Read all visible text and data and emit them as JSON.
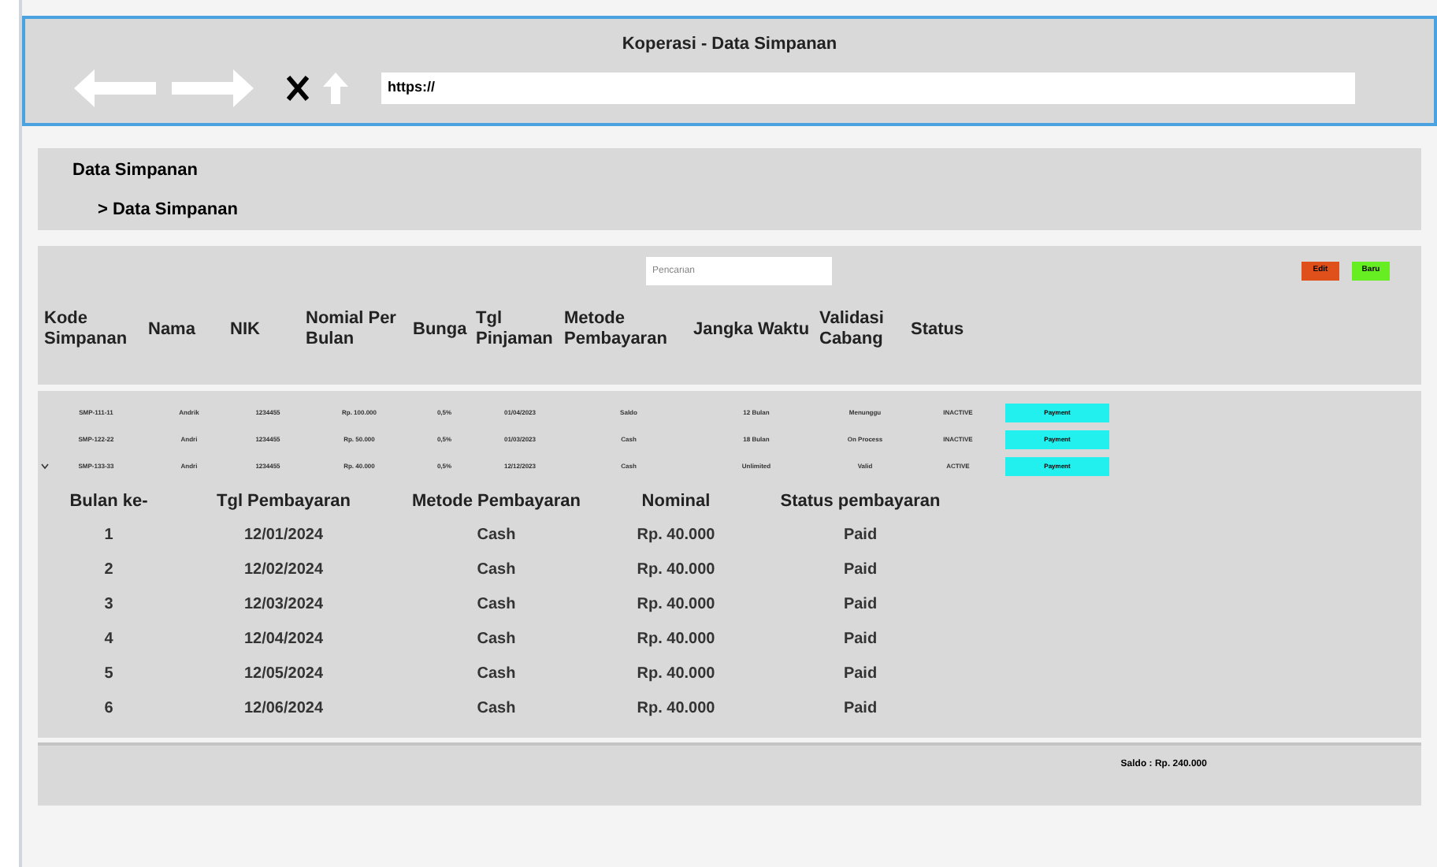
{
  "window": {
    "title": "Koperasi - Data Simpanan",
    "address": "https://"
  },
  "breadcrumb": {
    "title": "Data Simpanan",
    "item": "> Data Simpanan"
  },
  "toolbar": {
    "search_placeholder": "Pencarian",
    "buttons": [
      {
        "label": "Edit",
        "color": "#e0501a"
      },
      {
        "label": "Baru",
        "color": "#66ee22"
      }
    ]
  },
  "table": {
    "columns": [
      "Kode Simpanan",
      "Nama",
      "NIK",
      "Nomial Per Bulan",
      "Bunga",
      "Tgl Pinjaman",
      "Metode Pembayaran",
      "Jangka Waktu",
      "Validasi Cabang",
      "Status"
    ],
    "rows": [
      {
        "expanded": false,
        "cells": [
          "SMP-111-11",
          "Andrik",
          "1234455",
          "Rp. 100.000",
          "0,5%",
          "01/04/2023",
          "Saldo",
          "12 Bulan",
          "Menunggu",
          "INACTIVE"
        ],
        "action": "Payment"
      },
      {
        "expanded": false,
        "cells": [
          "SMP-122-22",
          "Andri",
          "1234455",
          "Rp. 50.000",
          "0,5%",
          "01/03/2023",
          "Cash",
          "18 Bulan",
          "On Process",
          "INACTIVE"
        ],
        "action": "Payment"
      },
      {
        "expanded": true,
        "cells": [
          "SMP-133-33",
          "Andri",
          "1234455",
          "Rp. 40.000",
          "0,5%",
          "12/12/2023",
          "Cash",
          "Unlimited",
          "Valid",
          "ACTIVE"
        ],
        "action": "Payment"
      }
    ]
  },
  "payments": {
    "columns": [
      "Bulan ke-",
      "Tgl Pembayaran",
      "Metode Pembayaran",
      "Nominal",
      "Status pembayaran"
    ],
    "rows": [
      [
        "1",
        "12/01/2024",
        "Cash",
        "Rp. 40.000",
        "Paid"
      ],
      [
        "2",
        "12/02/2024",
        "Cash",
        "Rp. 40.000",
        "Paid"
      ],
      [
        "3",
        "12/03/2024",
        "Cash",
        "Rp. 40.000",
        "Paid"
      ],
      [
        "4",
        "12/04/2024",
        "Cash",
        "Rp. 40.000",
        "Paid"
      ],
      [
        "5",
        "12/05/2024",
        "Cash",
        "Rp. 40.000",
        "Paid"
      ],
      [
        "6",
        "12/06/2024",
        "Cash",
        "Rp. 40.000",
        "Paid"
      ]
    ]
  },
  "saldo": "Saldo : Rp. 240.000"
}
